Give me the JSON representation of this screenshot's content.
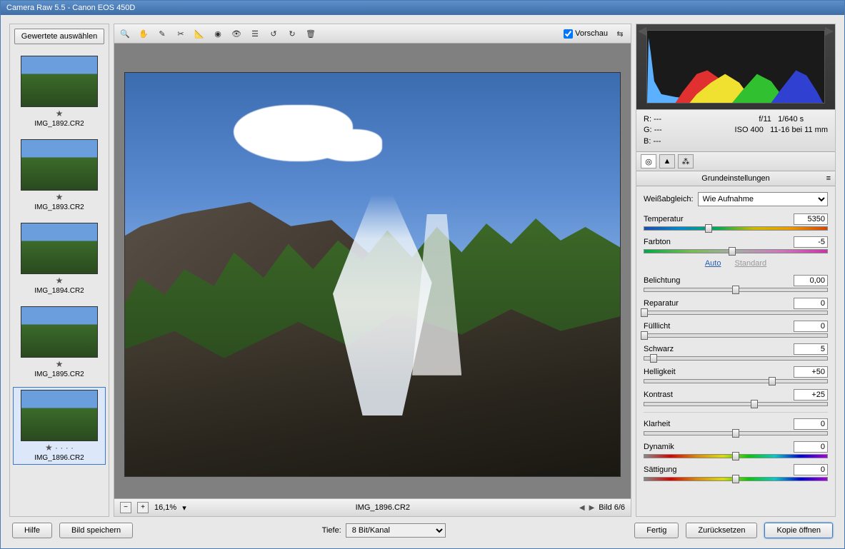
{
  "title": "Camera Raw 5.5 - Canon EOS 450D",
  "filmstrip": {
    "select_button": "Gewertete auswählen",
    "items": [
      {
        "name": "IMG_1892.CR2",
        "star": "★"
      },
      {
        "name": "IMG_1893.CR2",
        "star": "★"
      },
      {
        "name": "IMG_1894.CR2",
        "star": "★"
      },
      {
        "name": "IMG_1895.CR2",
        "star": "★"
      },
      {
        "name": "IMG_1896.CR2",
        "star": "★ · · · ·",
        "selected": true
      }
    ]
  },
  "toolbar": {
    "preview_label": "Vorschau",
    "preview_checked": true,
    "icons": [
      "zoom",
      "hand",
      "white-balance",
      "crop",
      "straighten",
      "spot",
      "redeye",
      "prefs",
      "rotate-ccw",
      "rotate-cw",
      "trash"
    ]
  },
  "zoom": {
    "level": "16,1%",
    "filename": "IMG_1896.CR2",
    "page": "Bild 6/6"
  },
  "exif": {
    "r": "R:",
    "g": "G:",
    "b": "B:",
    "rv": "---",
    "gv": "---",
    "bv": "---",
    "aperture": "f/11",
    "shutter": "1/640 s",
    "iso": "ISO 400",
    "lens": "11-16 bei 11 mm"
  },
  "panel": {
    "title": "Grundeinstellungen",
    "wb_label": "Weißabgleich:",
    "wb_value": "Wie Aufnahme",
    "auto": "Auto",
    "standard": "Standard",
    "sliders": {
      "temperatur": {
        "label": "Temperatur",
        "value": "5350",
        "pos": 35,
        "cls": "temp"
      },
      "farbton": {
        "label": "Farbton",
        "value": "-5",
        "pos": 48,
        "cls": "tint"
      },
      "belichtung": {
        "label": "Belichtung",
        "value": "0,00",
        "pos": 50,
        "cls": ""
      },
      "reparatur": {
        "label": "Reparatur",
        "value": "0",
        "pos": 0,
        "cls": ""
      },
      "fuelllicht": {
        "label": "Fülllicht",
        "value": "0",
        "pos": 0,
        "cls": ""
      },
      "schwarz": {
        "label": "Schwarz",
        "value": "5",
        "pos": 5,
        "cls": ""
      },
      "helligkeit": {
        "label": "Helligkeit",
        "value": "+50",
        "pos": 70,
        "cls": ""
      },
      "kontrast": {
        "label": "Kontrast",
        "value": "+25",
        "pos": 60,
        "cls": ""
      },
      "klarheit": {
        "label": "Klarheit",
        "value": "0",
        "pos": 50,
        "cls": ""
      },
      "dynamik": {
        "label": "Dynamik",
        "value": "0",
        "pos": 50,
        "cls": "sat"
      },
      "saettigung": {
        "label": "Sättigung",
        "value": "0",
        "pos": 50,
        "cls": "sat"
      }
    }
  },
  "bottom": {
    "help": "Hilfe",
    "save": "Bild speichern",
    "depth_label": "Tiefe:",
    "depth_value": "8 Bit/Kanal",
    "done": "Fertig",
    "reset": "Zurücksetzen",
    "open": "Kopie öffnen"
  }
}
